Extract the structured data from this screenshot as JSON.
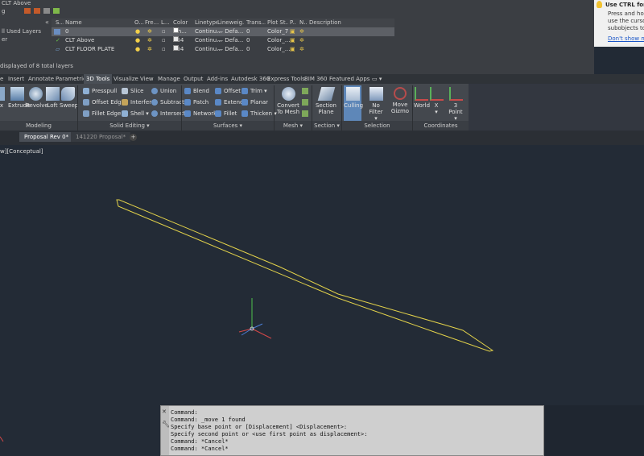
{
  "layer_panel": {
    "title_partial": "CLT Above",
    "tree_root_partial": "g",
    "tree_items": [
      "ll Used Layers",
      "er"
    ],
    "columns": [
      "S...",
      "Name",
      "O...",
      "Fre...",
      "L...",
      "Color",
      "Linetype",
      "Lineweig...",
      "Trans...",
      "Plot St...",
      "P...",
      "N...",
      "Description"
    ],
    "rows": [
      {
        "name": "0",
        "color": "wh...",
        "color_hex": "#ffffff",
        "linetype": "Continu...",
        "lineweight": "— Defa...",
        "transparency": "0",
        "plot_style": "Color_7",
        "selected": true
      },
      {
        "name": "CLT Above",
        "color": "254",
        "color_hex": "#e8e8e8",
        "linetype": "Continu...",
        "lineweight": "— Defa...",
        "transparency": "0",
        "plot_style": "Color_...",
        "selected": false
      },
      {
        "name": "CLT FLOOR PLATE",
        "color": "254",
        "color_hex": "#e8e8e8",
        "linetype": "Continu...",
        "lineweight": "— Defa...",
        "transparency": "0",
        "plot_style": "Color_...",
        "selected": false
      }
    ],
    "status": "displayed of 8 total layers"
  },
  "tooltip": {
    "title": "Use CTRL for sub",
    "body": [
      "Press and hold th",
      "use the cursor to",
      "subobjects to ma"
    ],
    "link": "Don't show me th"
  },
  "ribbon_tabs": [
    "e",
    "Insert",
    "Annotate",
    "Parametric",
    "3D Tools",
    "Visualize",
    "View",
    "Manage",
    "Output",
    "Add-ins",
    "Autodesk 360",
    "Express Tools",
    "BIM 360",
    "Featured Apps",
    "▭ ▾"
  ],
  "active_tab": "3D Tools",
  "ribbon": {
    "modeling": {
      "footer": "Modeling",
      "buttons": [
        "x",
        "Extrude",
        "Revolve",
        "Loft",
        "Sweep"
      ]
    },
    "solid_editing": {
      "footer": "Solid Editing ▾",
      "col1": [
        "Presspull",
        "Offset Edge",
        "Fillet Edge ▾"
      ],
      "col2": [
        "Slice",
        "Interfere",
        "Shell ▾"
      ],
      "col3": [
        "Union",
        "Subtract",
        "Intersect"
      ]
    },
    "surfaces": {
      "footer": "Surfaces ▾",
      "col1": [
        "Blend",
        "Patch",
        "Network"
      ],
      "col2": [
        "Offset",
        "Extend",
        "Fillet"
      ],
      "col3": [
        "Trim ▾",
        "Planar",
        "Thicken ▾"
      ]
    },
    "mesh": {
      "footer": "Mesh ▾",
      "convert": [
        "Convert",
        "To Mesh"
      ]
    },
    "section": {
      "footer": "Section ▾",
      "plane": [
        "Section",
        "Plane"
      ]
    },
    "selection": {
      "footer": "Selection",
      "culling": "Culling",
      "no_filter": "No Filter",
      "move_gizmo": [
        "Move",
        "Gizmo"
      ]
    },
    "coordinates": {
      "footer": "Coordinates",
      "world": "World",
      "x": "X",
      "three_point": "3 Point"
    }
  },
  "doc_tabs": {
    "active": "Proposal Rev 0*",
    "inactive": "141220 Proposal*",
    "plus": "+"
  },
  "viewport": {
    "label": "w][Conceptual]"
  },
  "command": {
    "lines": [
      "Command:",
      "Command: _move 1 found",
      "Specify base point or [Displacement] <Displacement>:",
      "Specify second point or <use first point as displacement>:",
      "Command: *Cancel*",
      "Command: *Cancel*"
    ]
  },
  "colors": {
    "viewport_bg": "#232b36",
    "geometry": "#e3d24a",
    "active_tab": "#4a4f56",
    "culling_active": "#5e87b8"
  }
}
